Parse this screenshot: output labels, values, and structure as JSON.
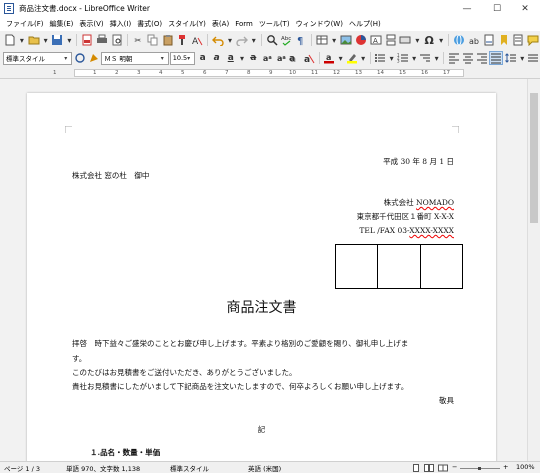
{
  "window": {
    "title": "商品注文書.docx - LibreOffice Writer",
    "minimize": "—",
    "maximize": "☐",
    "close": "✕"
  },
  "menu": [
    "ファイル(F)",
    "編集(E)",
    "表示(V)",
    "挿入(I)",
    "書式(O)",
    "スタイル(Y)",
    "表(A)",
    "Form",
    "ツール(T)",
    "ウィンドウ(W)",
    "ヘルプ(H)"
  ],
  "formatting": {
    "paragraph_style": "標準スタイル",
    "font_name": "ＭＳ 明朝",
    "font_size": "10.5"
  },
  "ruler": {
    "labels": [
      "1",
      "1",
      "2",
      "3",
      "4",
      "5",
      "6",
      "7",
      "8",
      "9",
      "10",
      "11",
      "12",
      "13",
      "14",
      "15",
      "16",
      "17"
    ]
  },
  "document": {
    "date": "平成 30 年 8 月 1 日",
    "recipient": "株式会社 窓の杜　御中",
    "sender_company_prefix": "株式会社 ",
    "sender_company_name": "NOMADO",
    "sender_address": "東京都千代田区１番町 X-X-X",
    "sender_tel_prefix": "TEL /FAX 03-",
    "sender_tel_number": "XXXX-XXXX",
    "heading": "商品注文書",
    "body_line1": "拝啓　時下益々ご盛栄のこととお慶び申し上げます。平素より格別のご愛顧を賜り、御礼申し上げま",
    "body_line2": "す。",
    "body_line3": "このたびはお見積書をご送付いただき、ありがとうございました。",
    "body_line4": "貴社お見積書にしたがいまして下記商品を注文いたしますので、何卒よろしくお願い申し上げます。",
    "closing": "敬具",
    "ki": "記",
    "partial_line": "１.品名・数量・単価"
  },
  "status": {
    "page": "ページ 1 / 3",
    "word_count": "単語 970、文字数 1,138",
    "page_style": "標準スタイル",
    "language": "英語 (米国)",
    "zoom_minus": "−",
    "zoom_plus": "+",
    "zoom": "100%"
  },
  "colors": {
    "accent": "#2b579a",
    "spell_error": "#e00000"
  }
}
